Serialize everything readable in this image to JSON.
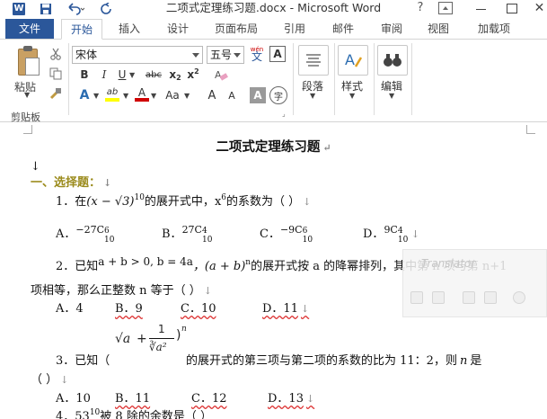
{
  "titlebar": {
    "word_logo": "W",
    "title": "二项式定理练习题.docx - Microsoft Word",
    "help": "?",
    "close": "✕"
  },
  "tabs": {
    "file": "文件",
    "items": [
      "开始",
      "插入",
      "设计",
      "页面布局",
      "引用",
      "邮件",
      "审阅",
      "视图",
      "加载项"
    ],
    "active": "开始"
  },
  "ribbon": {
    "clipboard": {
      "paste_label": "粘贴",
      "group_label": "剪贴板"
    },
    "font": {
      "font_name": "宋体",
      "font_size": "五号",
      "phonetic": "wén",
      "bold": "B",
      "italic": "I",
      "underline": "U",
      "strike": "abc",
      "subscript_x": "x",
      "subscript_2": "2",
      "superscript_x": "x",
      "superscript_2": "2",
      "effects": "A",
      "highlight": "ab",
      "font_color": "A",
      "change_case": "Aa",
      "grow": "A",
      "shrink": "A",
      "shade_char": "A",
      "enclose_char": "字",
      "char_border": "A"
    },
    "paragraph_label": "段落",
    "styles_label": "样式",
    "editing_label": "编辑"
  },
  "document": {
    "title": "二项式定理练习题",
    "section_heading": "一、选择题：",
    "q1": {
      "text_prefix": "1．在",
      "expr_open": "(x − √3)",
      "expr_exp": "10",
      "text_mid": "的展开式中，",
      "x_base": "x",
      "x_exp": "6",
      "text_end": "的系数为（  ）",
      "options": [
        {
          "label": "A．",
          "coef": "−27C",
          "sup": "6",
          "sub": "10"
        },
        {
          "label": "B．",
          "coef": "27C",
          "sup": "4",
          "sub": "10"
        },
        {
          "label": "C．",
          "coef": "−9C",
          "sup": "6",
          "sub": "10"
        },
        {
          "label": "D．",
          "coef": "9C",
          "sup": "4",
          "sub": "10"
        }
      ]
    },
    "q2": {
      "line1_prefix": "2．已知",
      "line1_cond": "a + b > 0, b = 4a",
      "line1_expr": "，(a + b)",
      "line1_exp": "n",
      "line1_text": "的展开式按 a 的降幂排列，其中第 n 项与第 n+1",
      "line2_text": "项相等，那么正整数 n 等于（  ）",
      "options": [
        "A．4",
        "B．9",
        "C．10",
        "D．11"
      ]
    },
    "q3": {
      "frac_num": "1",
      "frac_den": "∛a²",
      "root": "√a",
      "plus": "+",
      "exp": "n",
      "line_prefix": "3．已知（",
      "line_text": "的展开式的第三项与第二项的系数的比为 11：2，则",
      "n_var": "n",
      "line_end": "是",
      "line2": "（  ）",
      "options": [
        "A．10",
        "B．11",
        "C．12",
        "D．13"
      ]
    },
    "q4": {
      "prefix": "4．",
      "base": "53",
      "exp": "10",
      "text": "被 8 除的余数是（  ）"
    },
    "paragraph_mark": "↵",
    "return_mark": "↓"
  },
  "translator_overlay": {
    "title": "Translator"
  }
}
